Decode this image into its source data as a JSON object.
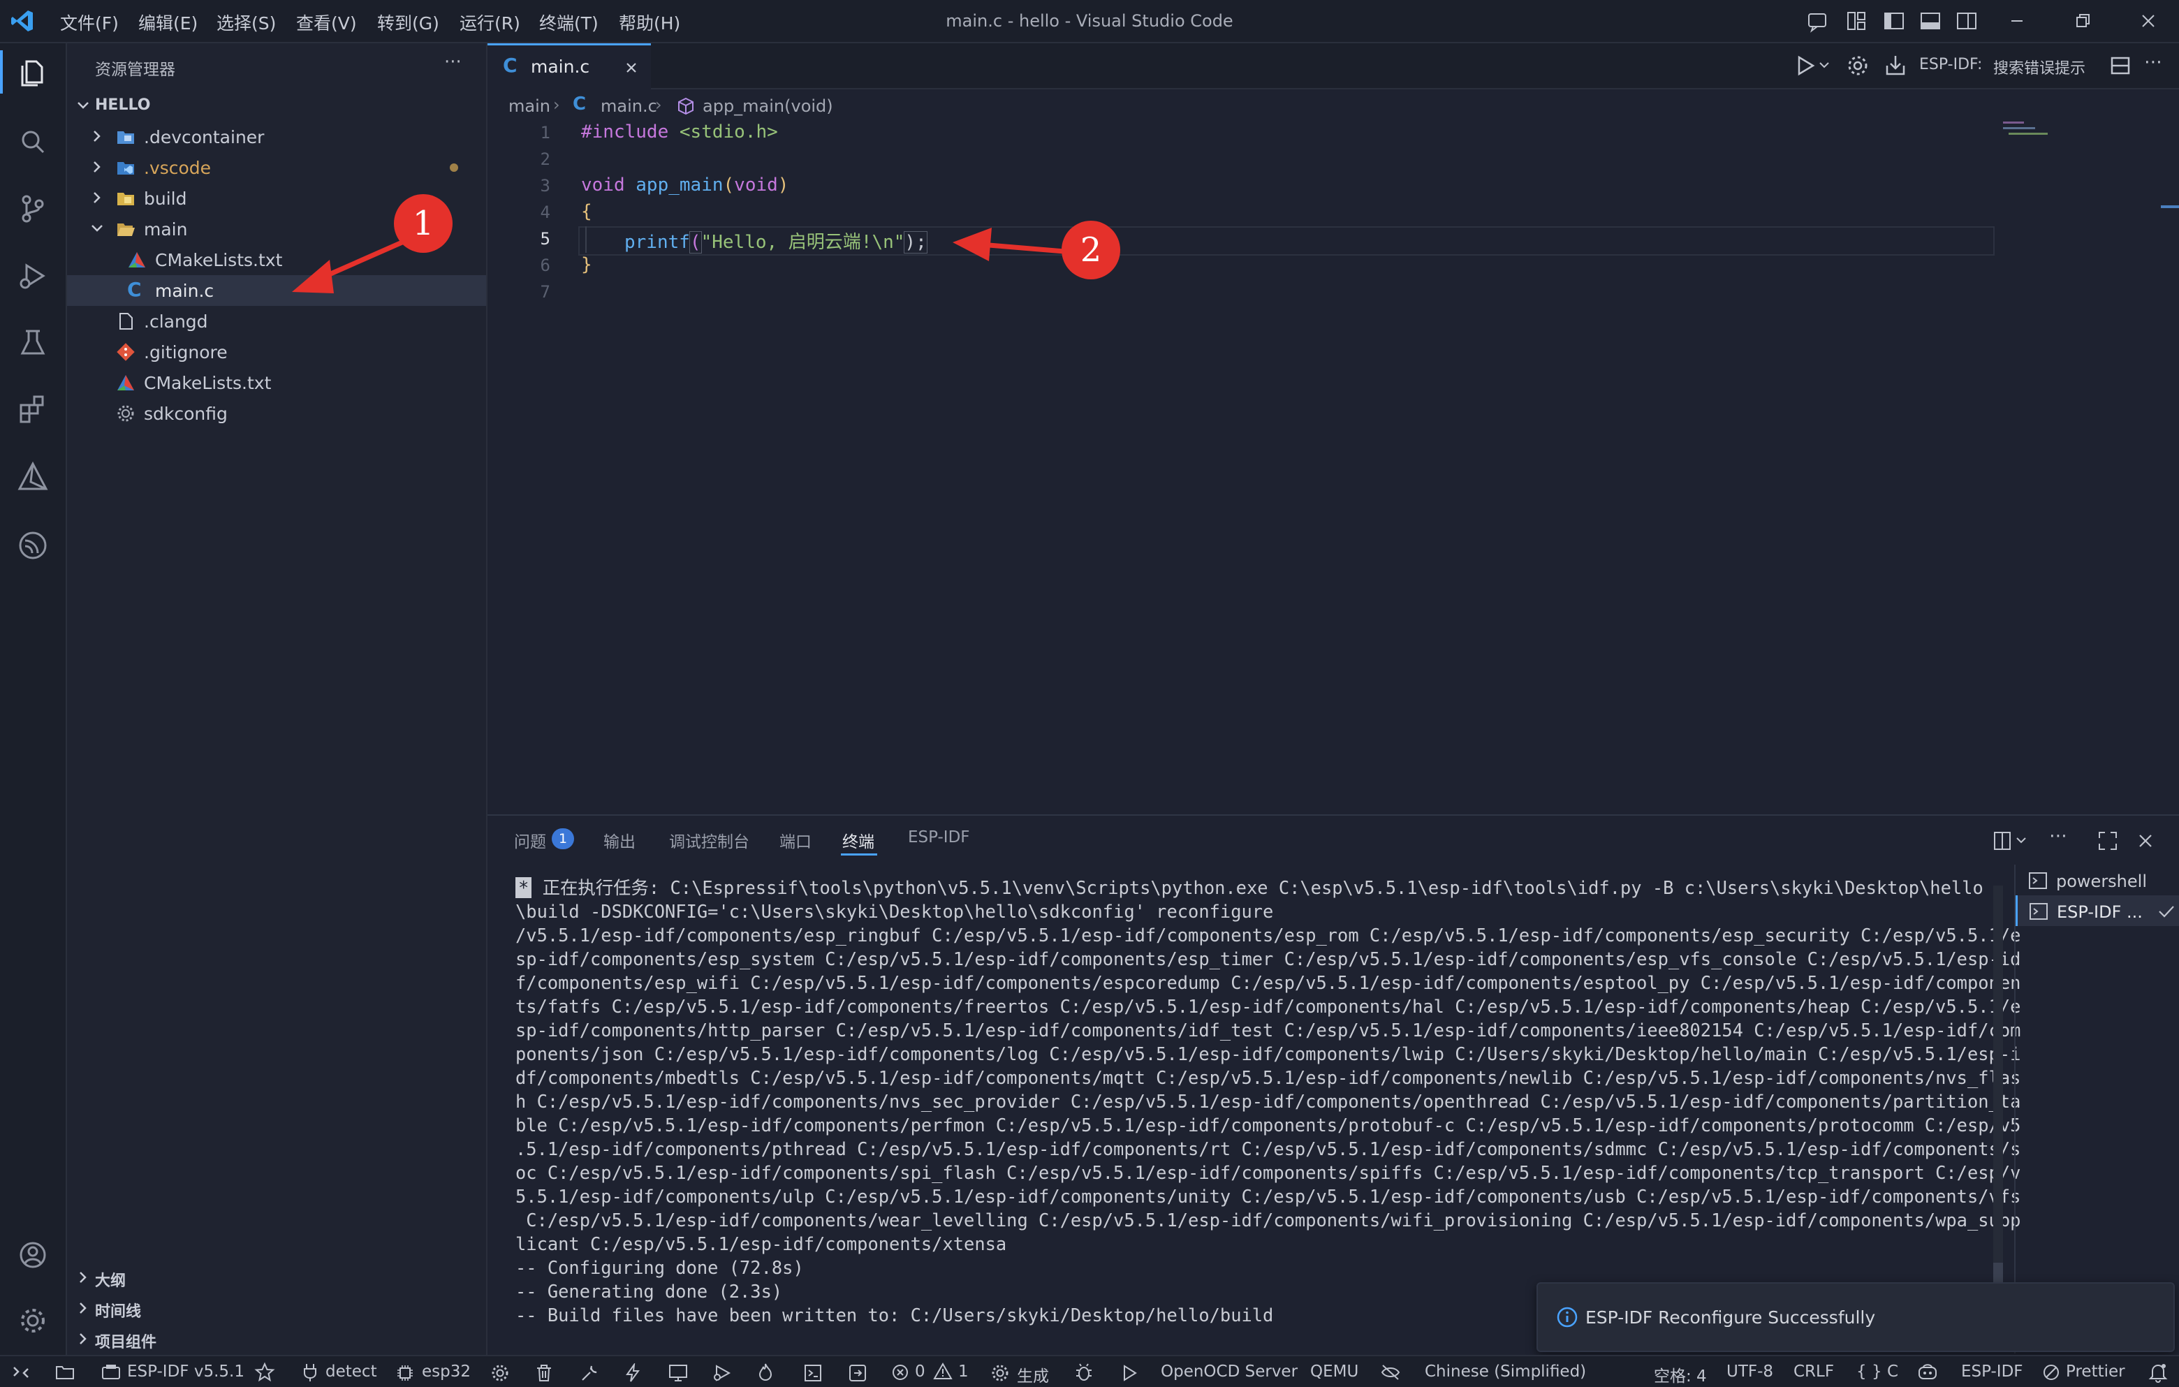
{
  "window": {
    "title": "main.c - hello - Visual Studio Code",
    "menu": [
      "文件(F)",
      "编辑(E)",
      "选择(S)",
      "查看(V)",
      "转到(G)",
      "运行(R)",
      "终端(T)",
      "帮助(H)"
    ]
  },
  "sidebar": {
    "title": "资源管理器",
    "more": "···",
    "root": "HELLO",
    "items": [
      {
        "label": ".devcontainer"
      },
      {
        "label": ".vscode"
      },
      {
        "label": "build"
      },
      {
        "label": "main"
      },
      {
        "label": "CMakeLists.txt"
      },
      {
        "label": "main.c"
      },
      {
        "label": ".clangd"
      },
      {
        "label": ".gitignore"
      },
      {
        "label": "CMakeLists.txt"
      },
      {
        "label": "sdkconfig"
      }
    ],
    "sections": [
      "大纲",
      "时间线",
      "项目组件"
    ]
  },
  "editor": {
    "tab": {
      "label": "main.c",
      "icon": "C"
    },
    "actions": {
      "espidf_label": "ESP-IDF:",
      "hint": "搜索错误提示"
    },
    "breadcrumb": {
      "folder": "main",
      "file": "main.c",
      "symbol": "app_main(void)"
    },
    "lines": [
      {
        "n": "1"
      },
      {
        "n": "2"
      },
      {
        "n": "3"
      },
      {
        "n": "4"
      },
      {
        "n": "5"
      },
      {
        "n": "6"
      },
      {
        "n": "7"
      }
    ],
    "code": {
      "l1_kw": "#include",
      "l1_hdr": "<stdio.h>",
      "l3_type": "void",
      "l3_fn": "app_main",
      "l3_open": "(",
      "l3_arg": "void",
      "l3_close": ")",
      "l4": "{",
      "l5_fn": "printf",
      "l5_open": "(",
      "l5_str": "\"Hello, 启明云端!\\n\"",
      "l5_close": ");",
      "l6": "}"
    }
  },
  "panel": {
    "tabs": {
      "problems": "问题",
      "problems_count": "1",
      "output": "输出",
      "debug": "调试控制台",
      "ports": "端口",
      "terminal": "终端",
      "espidf": "ESP-IDF"
    },
    "terminal_lines": [
      "* 正在执行任务: C:\\Espressif\\tools\\python\\v5.5.1\\venv\\Scripts\\python.exe C:\\esp\\v5.5.1\\esp-idf\\tools\\idf.py -B c:\\Users\\skyki\\Desktop\\hello",
      "\\build -DSDKCONFIG='c:\\Users\\skyki\\Desktop\\hello\\sdkconfig' reconfigure",
      "/v5.5.1/esp-idf/components/esp_ringbuf C:/esp/v5.5.1/esp-idf/components/esp_rom C:/esp/v5.5.1/esp-idf/components/esp_security C:/esp/v5.5.1/e",
      "sp-idf/components/esp_system C:/esp/v5.5.1/esp-idf/components/esp_timer C:/esp/v5.5.1/esp-idf/components/esp_vfs_console C:/esp/v5.5.1/esp-id",
      "f/components/esp_wifi C:/esp/v5.5.1/esp-idf/components/espcoredump C:/esp/v5.5.1/esp-idf/components/esptool_py C:/esp/v5.5.1/esp-idf/componen",
      "ts/fatfs C:/esp/v5.5.1/esp-idf/components/freertos C:/esp/v5.5.1/esp-idf/components/hal C:/esp/v5.5.1/esp-idf/components/heap C:/esp/v5.5.1/e",
      "sp-idf/components/http_parser C:/esp/v5.5.1/esp-idf/components/idf_test C:/esp/v5.5.1/esp-idf/components/ieee802154 C:/esp/v5.5.1/esp-idf/com",
      "ponents/json C:/esp/v5.5.1/esp-idf/components/log C:/esp/v5.5.1/esp-idf/components/lwip C:/Users/skyki/Desktop/hello/main C:/esp/v5.5.1/esp-i",
      "df/components/mbedtls C:/esp/v5.5.1/esp-idf/components/mqtt C:/esp/v5.5.1/esp-idf/components/newlib C:/esp/v5.5.1/esp-idf/components/nvs_flas",
      "h C:/esp/v5.5.1/esp-idf/components/nvs_sec_provider C:/esp/v5.5.1/esp-idf/components/openthread C:/esp/v5.5.1/esp-idf/components/partition_ta",
      "ble C:/esp/v5.5.1/esp-idf/components/perfmon C:/esp/v5.5.1/esp-idf/components/protobuf-c C:/esp/v5.5.1/esp-idf/components/protocomm C:/esp/v5",
      ".5.1/esp-idf/components/pthread C:/esp/v5.5.1/esp-idf/components/rt C:/esp/v5.5.1/esp-idf/components/sdmmc C:/esp/v5.5.1/esp-idf/components/s",
      "oc C:/esp/v5.5.1/esp-idf/components/spi_flash C:/esp/v5.5.1/esp-idf/components/spiffs C:/esp/v5.5.1/esp-idf/components/tcp_transport C:/esp/v",
      "5.5.1/esp-idf/components/ulp C:/esp/v5.5.1/esp-idf/components/unity C:/esp/v5.5.1/esp-idf/components/usb C:/esp/v5.5.1/esp-idf/components/vfs",
      " C:/esp/v5.5.1/esp-idf/components/wear_levelling C:/esp/v5.5.1/esp-idf/components/wifi_provisioning C:/esp/v5.5.1/esp-idf/components/wpa_supp",
      "licant C:/esp/v5.5.1/esp-idf/components/xtensa",
      "-- Configuring done (72.8s)",
      "-- Generating done (2.3s)",
      "-- Build files have been written to: C:/Users/skyki/Desktop/hello/build"
    ],
    "terminals": [
      "powershell",
      "ESP-IDF ..."
    ]
  },
  "notification": {
    "text": "ESP-IDF Reconfigure Successfully"
  },
  "statusbar": {
    "idf_version": "ESP-IDF v5.5.1",
    "detect": "detect",
    "target": "esp32",
    "errors": "0",
    "warnings": "1",
    "build": "生成",
    "openocd": "OpenOCD Server",
    "qemu": "QEMU",
    "language_pack": "Chinese (Simplified)",
    "spaces": "空格: 4",
    "encoding": "UTF-8",
    "eol": "CRLF",
    "language": "C",
    "espidf": "ESP-IDF",
    "prettier": "Prettier"
  },
  "annotations": {
    "badge1": "1",
    "badge2": "2"
  },
  "colors": {
    "accent": "#4aa3ff",
    "annotation": "#e5312b",
    "keyword": "#c678dd",
    "string": "#98c379",
    "function": "#61afef"
  }
}
